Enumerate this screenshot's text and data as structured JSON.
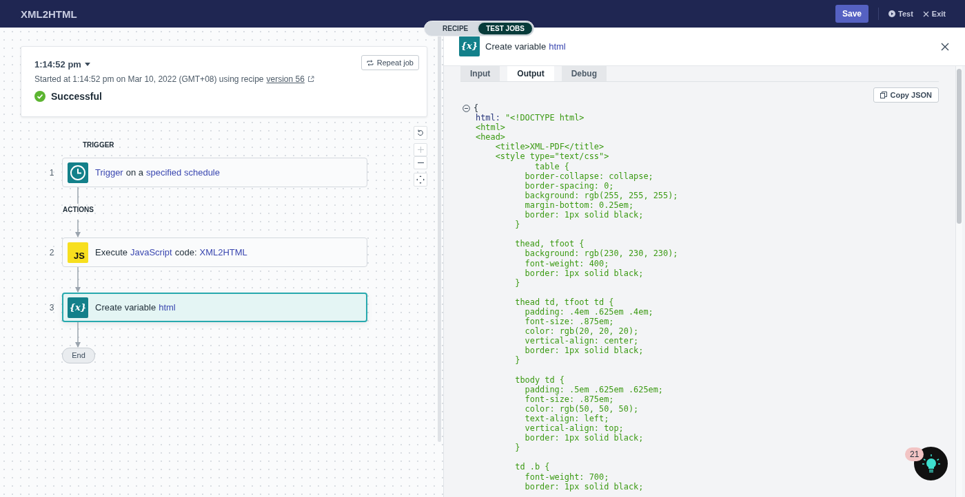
{
  "header": {
    "app_title": "XML2HTML",
    "save": "Save",
    "test": "Test",
    "exit": "Exit"
  },
  "mode_tabs": [
    {
      "label": "RECIPE",
      "selected": false
    },
    {
      "label": "TEST JOBS",
      "selected": true
    }
  ],
  "job": {
    "time": "1:14:52 pm",
    "repeat": "Repeat job",
    "started": "Started at 1:14:52 pm on Mar 10, 2022 (GMT+08) using recipe",
    "version_link": "version 56",
    "status": "Successful"
  },
  "flow": {
    "trigger_label": "TRIGGER",
    "actions_label": "ACTIONS",
    "end_label": "End",
    "steps": [
      {
        "number": "1",
        "kind": "schedule",
        "selected": false,
        "segments": [
          {
            "text": "Trigger",
            "link": true
          },
          {
            "text": "on a",
            "link": false
          },
          {
            "text": "specified schedule",
            "link": true
          }
        ]
      },
      {
        "number": "2",
        "kind": "javascript",
        "icon_label": "JS",
        "selected": false,
        "segments": [
          {
            "text": "Execute",
            "link": false
          },
          {
            "text": "JavaScript",
            "link": true
          },
          {
            "text": "code:",
            "link": false
          },
          {
            "text": "XML2HTML",
            "link": true
          }
        ]
      },
      {
        "number": "3",
        "kind": "variable",
        "icon_label": "{x}",
        "selected": true,
        "segments": [
          {
            "text": "Create variable",
            "link": false
          },
          {
            "text": "html",
            "link": true
          }
        ]
      }
    ]
  },
  "detail": {
    "icon_label": "{x}",
    "title_segments": [
      {
        "text": "Create variable",
        "link": false
      },
      {
        "text": "html",
        "link": true
      }
    ],
    "tabs": [
      {
        "label": "Input",
        "selected": false
      },
      {
        "label": "Output",
        "selected": true
      },
      {
        "label": "Debug",
        "selected": false
      }
    ],
    "copy_button": "Copy JSON",
    "open_brace": "{",
    "key": "html:",
    "key_value": " \"<!DOCTYPE html>",
    "blocks": [
      [
        "<html>",
        "<head>",
        "    <title>XML-PDF</title>",
        "    <style type=\"text/css\">",
        "            table {",
        "          border-collapse: collapse;",
        "          border-spacing: 0;",
        "          background: rgb(255, 255, 255);",
        "          margin-bottom: 0.25em;",
        "          border: 1px solid black;",
        "        }"
      ],
      [
        "        thead, tfoot {",
        "          background: rgb(230, 230, 230);",
        "          font-weight: 400;",
        "          border: 1px solid black;",
        "        }"
      ],
      [
        "        thead td, tfoot td {",
        "          padding: .4em .625em .4em;",
        "          font-size: .875em;",
        "          color: rgb(20, 20, 20);",
        "          vertical-align: center;",
        "          border: 1px solid black;",
        "        }"
      ],
      [
        "        tbody td {",
        "          padding: .5em .625em .625em;",
        "          font-size: .875em;",
        "          color: rgb(50, 50, 50);",
        "          text-align: left;",
        "          vertical-align: top;",
        "          border: 1px solid black;",
        "        }"
      ],
      [
        "        td .b {",
        "          font-weight: 700;",
        "          border: 1px solid black;"
      ]
    ]
  },
  "assistant": {
    "badge": "21"
  }
}
